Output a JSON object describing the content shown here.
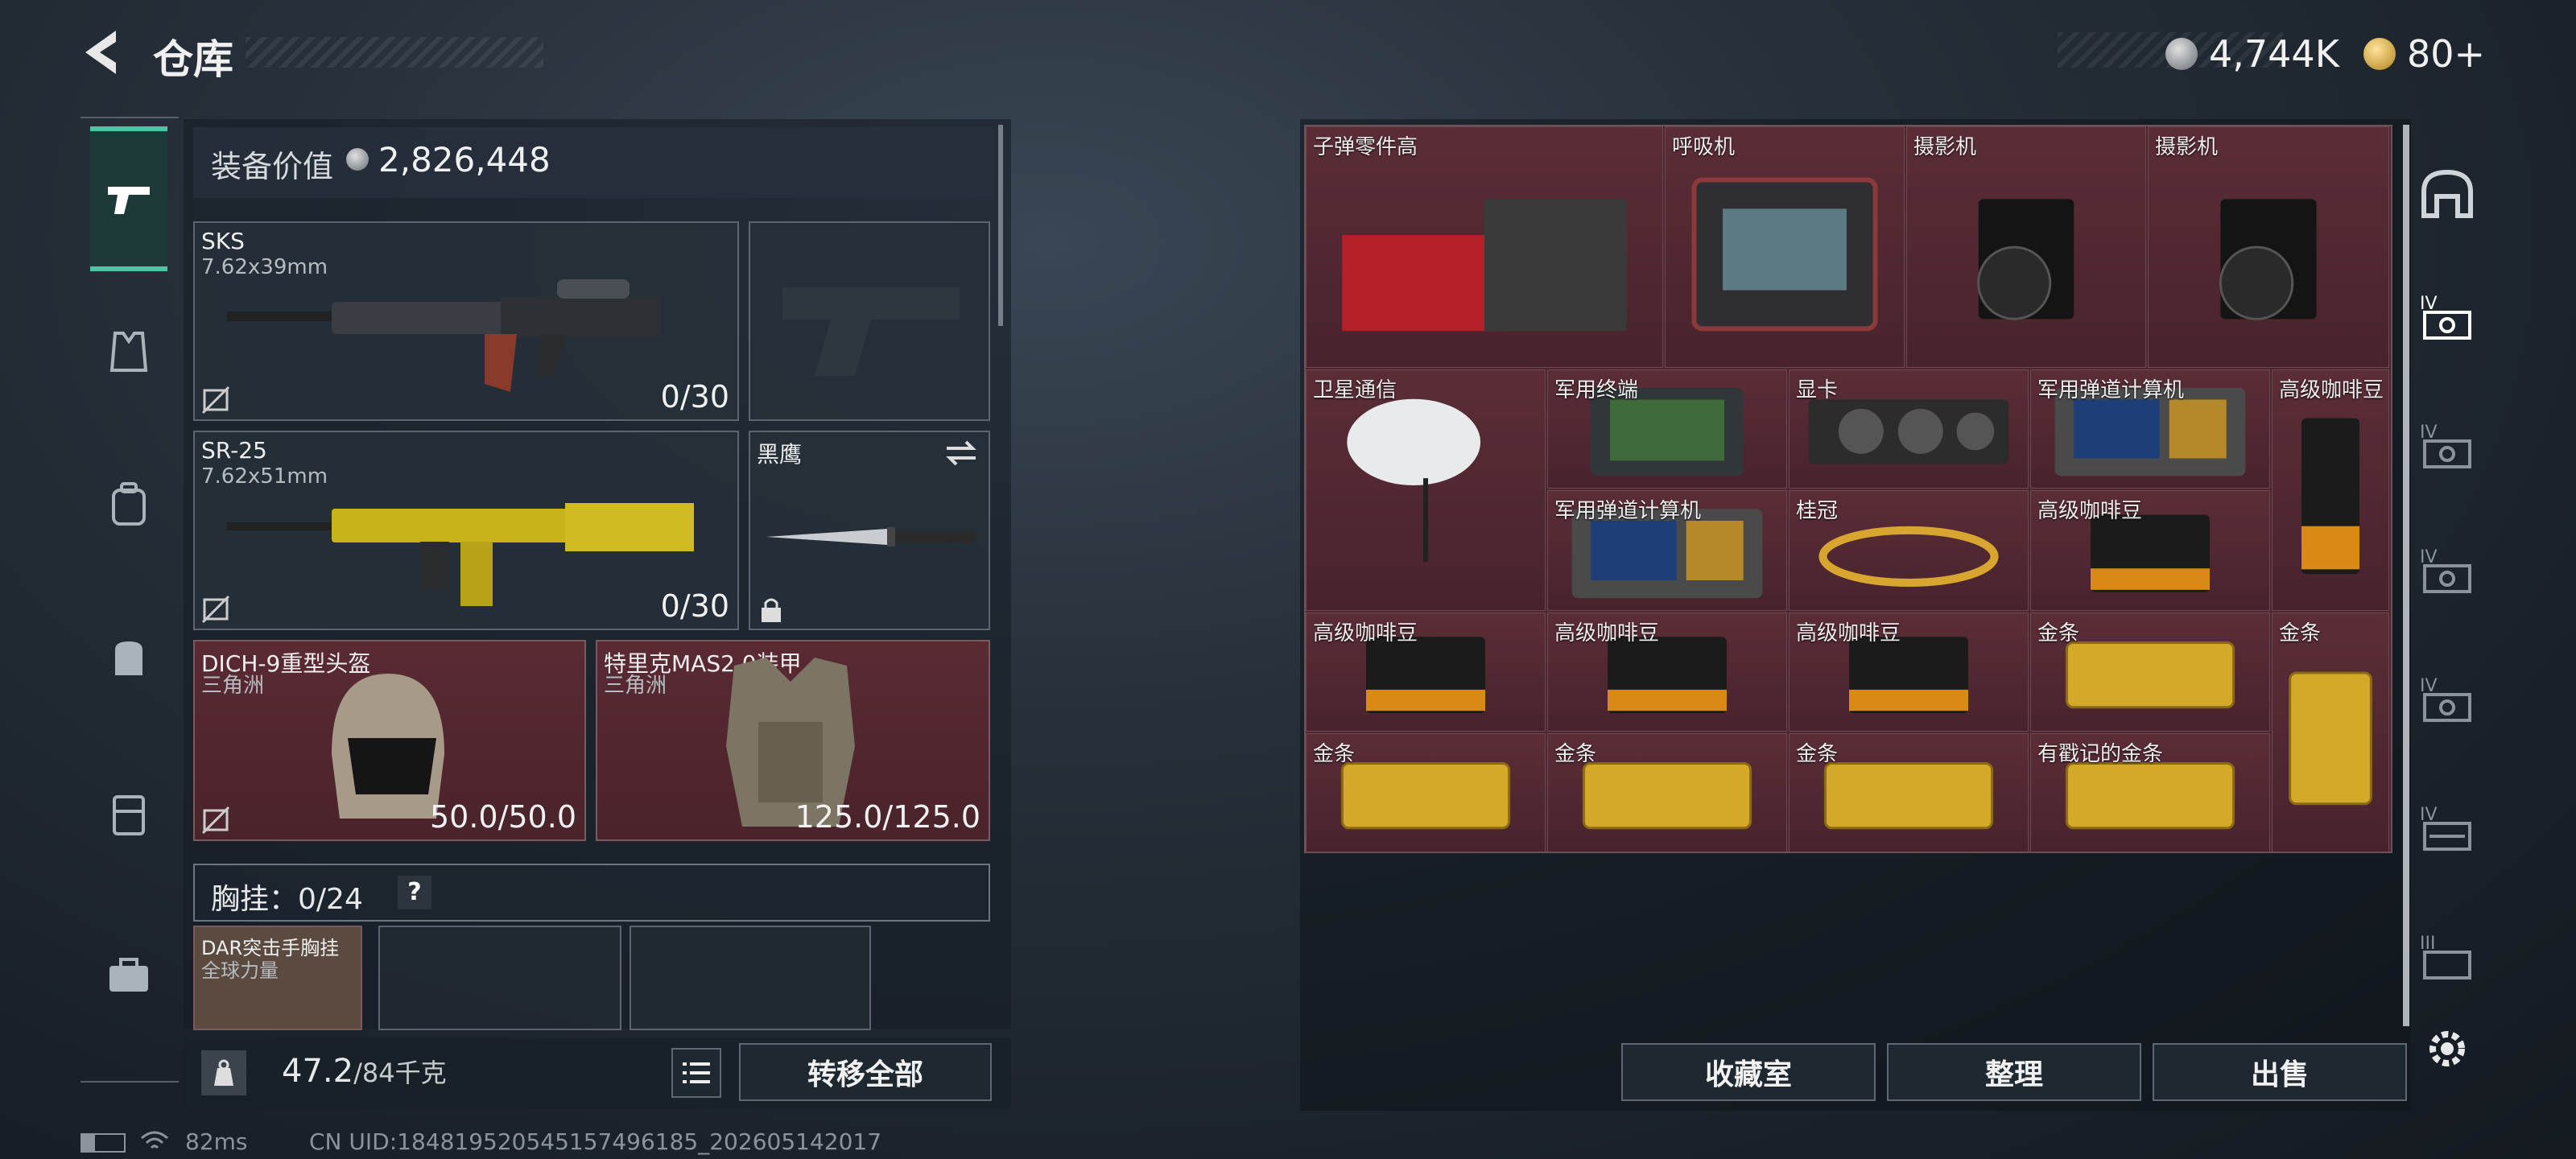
{
  "header": {
    "title": "仓库",
    "currency_silver": "4,744K",
    "currency_gold": "80+"
  },
  "equipment": {
    "label": "装备价值",
    "value": "2,826,448"
  },
  "slots": {
    "primary": {
      "name": "SKS",
      "ammo_type": "7.62x39mm",
      "ammo": "0/30"
    },
    "secondary": {
      "name": "SR-25",
      "ammo_type": "7.62x51mm",
      "ammo": "0/30"
    },
    "melee": {
      "name": "黑鹰"
    },
    "helmet": {
      "name": "DICH-9重型头盔",
      "origin": "三角洲",
      "durability": "50.0/50.0"
    },
    "armor": {
      "name": "特里克MAS2.0装甲",
      "origin": "三角洲",
      "durability": "125.0/125.0"
    }
  },
  "chest_rig": {
    "label": "胸挂：",
    "capacity": "0/24",
    "help": "?",
    "item_name": "DAR突击手胸挂",
    "item_origin": "全球力量"
  },
  "weight": {
    "current": "47.2",
    "max": "/84千克"
  },
  "buttons": {
    "transfer_all": "转移全部",
    "collection": "收藏室",
    "sort": "整理",
    "sell": "出售"
  },
  "storage_items": [
    {
      "label": "子弹零件高"
    },
    {
      "label": "呼吸机"
    },
    {
      "label": "摄影机"
    },
    {
      "label": "摄影机"
    },
    {
      "label": "卫星通信"
    },
    {
      "label": "军用终端"
    },
    {
      "label": "显卡"
    },
    {
      "label": "军用弹道计算机"
    },
    {
      "label": "高级咖啡豆"
    },
    {
      "label": "军用弹道计算机"
    },
    {
      "label": "桂冠"
    },
    {
      "label": "高级咖啡豆"
    },
    {
      "label": "高级咖啡豆"
    },
    {
      "label": "高级咖啡豆"
    },
    {
      "label": "高级咖啡豆"
    },
    {
      "label": "金条"
    },
    {
      "label": "金条"
    },
    {
      "label": "金条"
    },
    {
      "label": "金条"
    },
    {
      "label": "金条"
    },
    {
      "label": "有戳记的金条"
    }
  ],
  "status": {
    "ping": "82ms",
    "uid": "CN UID:18481952054515749618​5_202605142017"
  }
}
